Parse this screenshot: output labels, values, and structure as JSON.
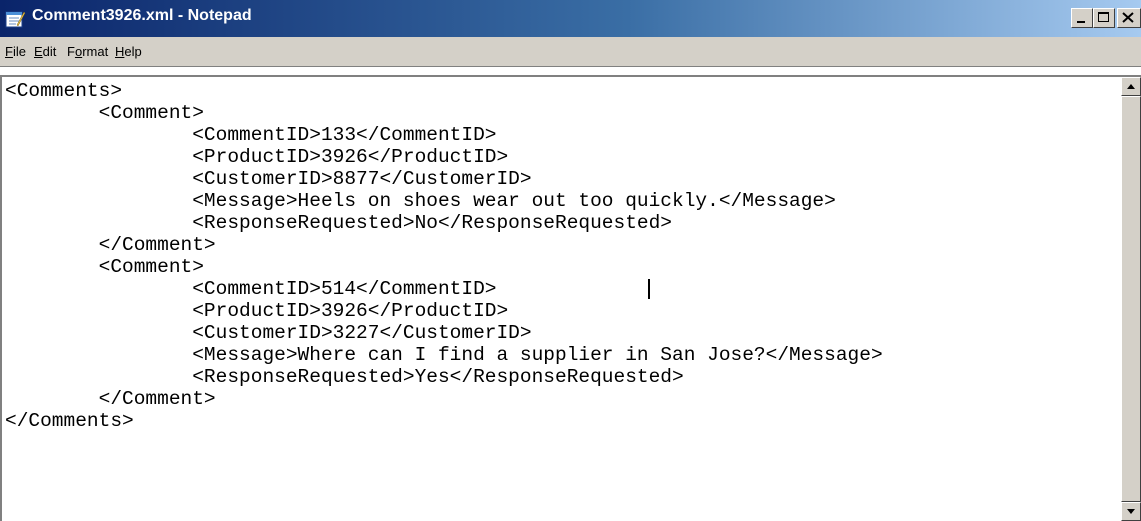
{
  "window": {
    "title": "Comment3926.xml - Notepad"
  },
  "menu": {
    "items": [
      {
        "key": "F",
        "rest": "ile"
      },
      {
        "key": "E",
        "rest": "dit"
      },
      {
        "pre": "F",
        "key": "o",
        "rest": "rmat"
      },
      {
        "key": "H",
        "rest": "elp"
      }
    ]
  },
  "icons": {
    "app": "notepad-icon",
    "minimize": "minimize-icon",
    "maximize": "maximize-icon",
    "close": "close-icon",
    "scroll_up": "scroll-up-arrow-icon",
    "scroll_down": "scroll-down-arrow-icon"
  },
  "document": {
    "lines": [
      "<Comments>",
      "        <Comment>",
      "                <CommentID>133</CommentID>",
      "                <ProductID>3926</ProductID>",
      "                <CustomerID>8877</CustomerID>",
      "                <Message>Heels on shoes wear out too quickly.</Message>",
      "                <ResponseRequested>No</ResponseRequested>",
      "        </Comment>",
      "        <Comment>",
      "                <CommentID>514</CommentID>",
      "                <ProductID>3926</ProductID>",
      "                <CustomerID>3227</CustomerID>",
      "                <Message>Where can I find a supplier in San Jose?</Message>",
      "                <ResponseRequested>Yes</ResponseRequested>",
      "        </Comment>",
      "</Comments>"
    ]
  }
}
